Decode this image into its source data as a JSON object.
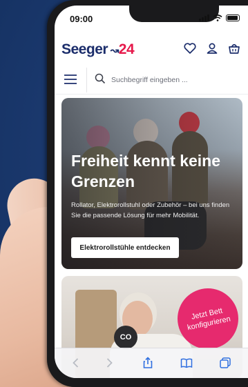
{
  "status": {
    "time": "09:00"
  },
  "header": {
    "logo_text": "Seeger",
    "logo_number": "24"
  },
  "search": {
    "placeholder": "Suchbegriff eingeben ..."
  },
  "hero": {
    "title": "Freiheit kennt keine Grenzen",
    "text": "Rollator, Elektrorollstuhl oder Zubehör – bei uns finden Sie die passende Lösung für mehr Mobilität.",
    "button_label": "Elektrorollstühle entdecken"
  },
  "card2": {
    "badge_text": "Jetzt Bett konfigurieren"
  },
  "cookie": {
    "label": "CO"
  },
  "colors": {
    "brand_navy": "#1b2d6b",
    "brand_red": "#e6194b",
    "badge_pink": "#e62a6e",
    "background_blue": "#1d3f7a"
  },
  "icons": [
    "signal-icon",
    "wifi-icon",
    "battery-icon",
    "heart-icon",
    "user-icon",
    "basket-icon",
    "menu-icon",
    "search-icon",
    "back-icon",
    "forward-icon",
    "share-icon",
    "bookmarks-icon",
    "tabs-icon"
  ]
}
